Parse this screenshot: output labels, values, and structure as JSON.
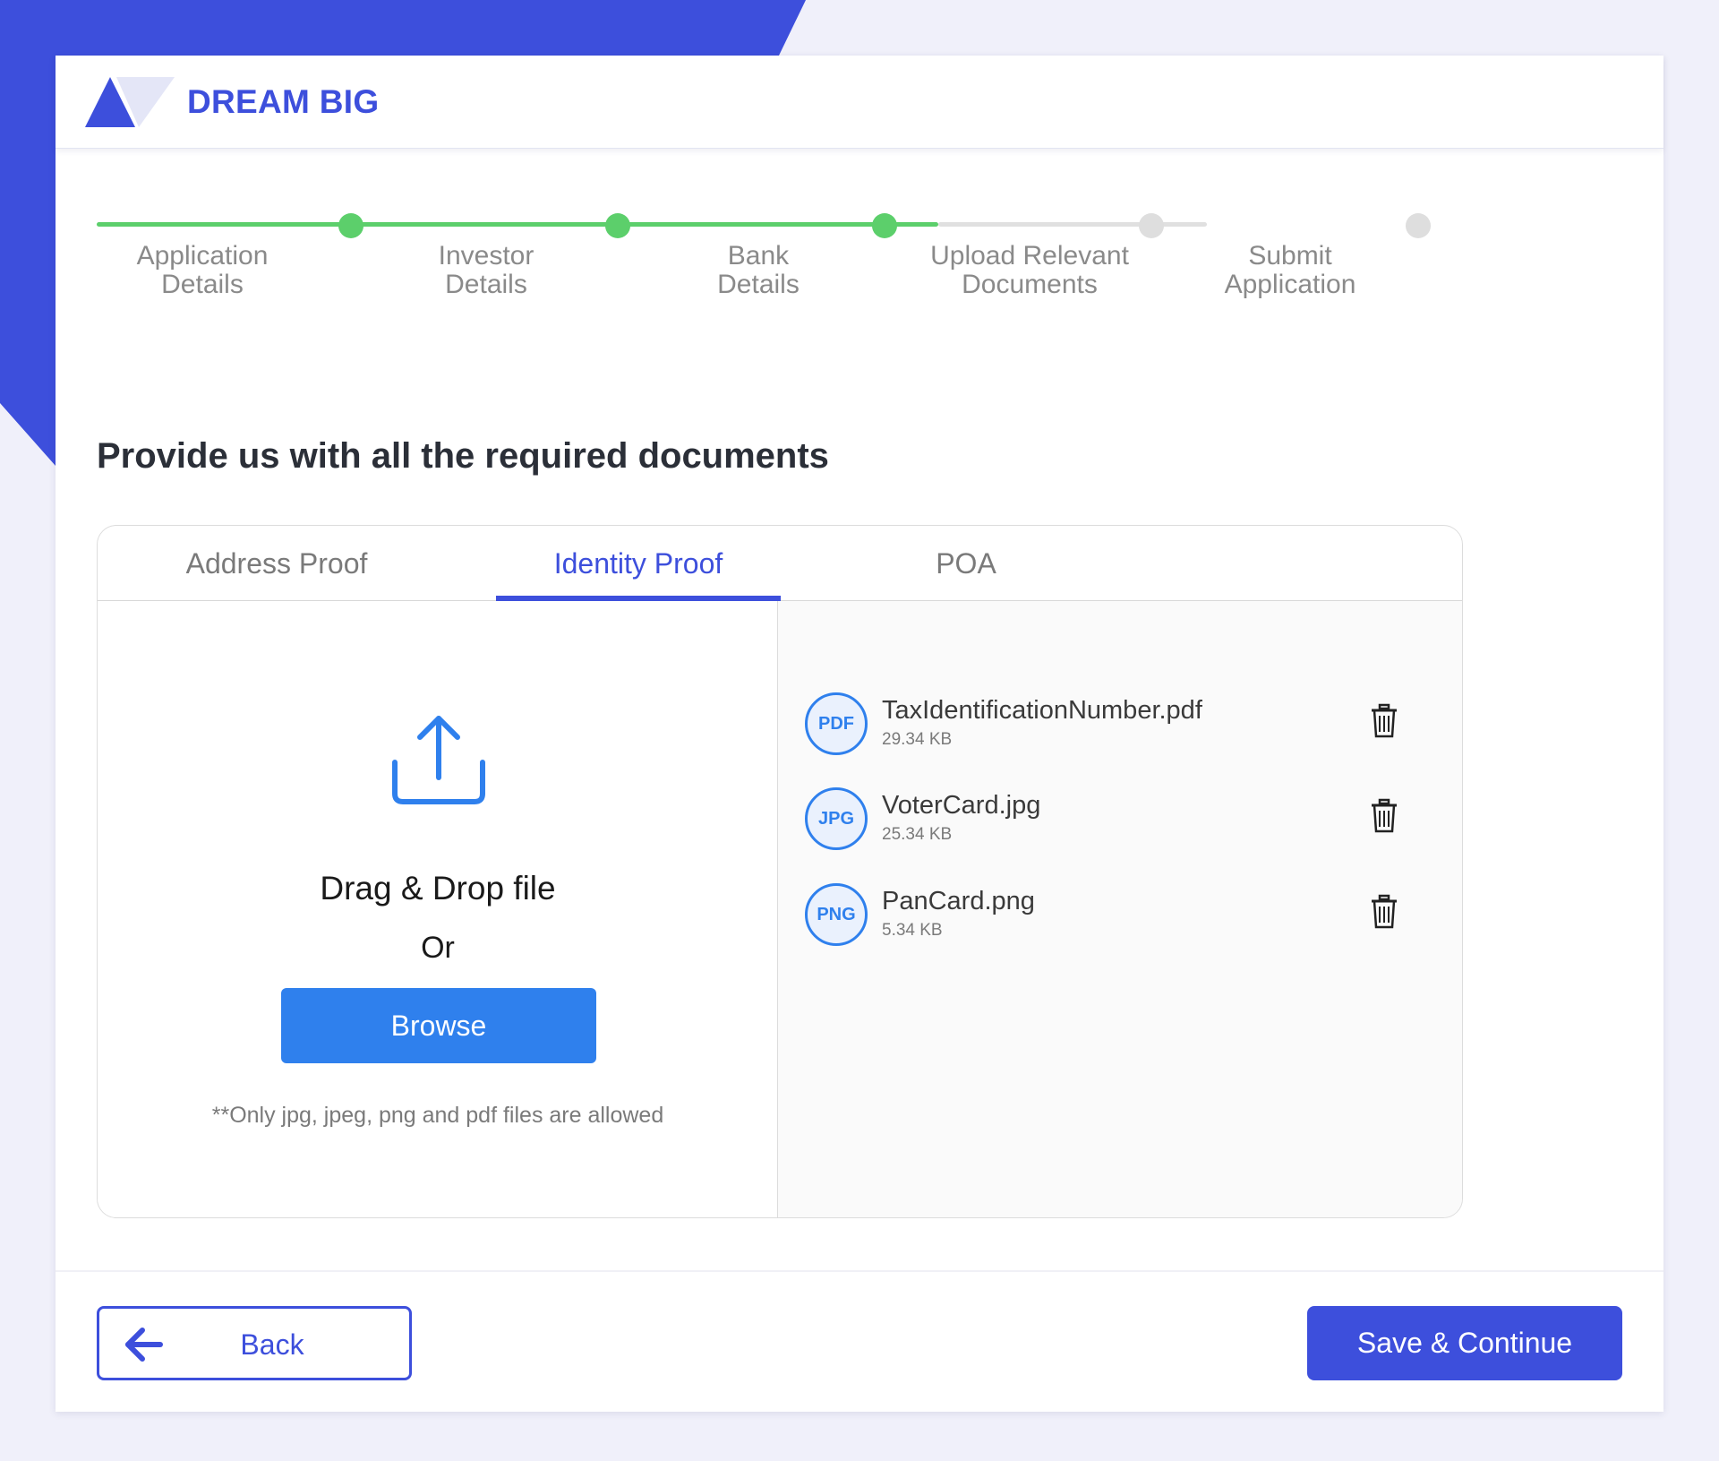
{
  "brand": {
    "name": "DREAM BIG",
    "logo_icon": "triangle-logo-icon"
  },
  "stepper": {
    "steps": [
      {
        "line1": "Application",
        "line2": "Details",
        "status": "complete"
      },
      {
        "line1": "Investor",
        "line2": "Details",
        "status": "complete"
      },
      {
        "line1": "Bank",
        "line2": "Details",
        "status": "complete"
      },
      {
        "line1": "Upload Relevant",
        "line2": "Documents",
        "status": "current"
      },
      {
        "line1": "Submit",
        "line2": "Application",
        "status": "pending"
      }
    ]
  },
  "page_title": "Provide us with all the required documents",
  "tabs": [
    {
      "label": "Address Proof",
      "active": false
    },
    {
      "label": "Identity Proof",
      "active": true
    },
    {
      "label": "POA",
      "active": false
    }
  ],
  "upload": {
    "drag_text": "Drag & Drop file",
    "or_text": "Or",
    "browse_label": "Browse",
    "note": "**Only jpg, jpeg, png and pdf files are allowed"
  },
  "files": [
    {
      "type": "PDF",
      "name": "TaxIdentificationNumber.pdf",
      "size": "29.34 KB"
    },
    {
      "type": "JPG",
      "name": "VoterCard.jpg",
      "size": "25.34 KB"
    },
    {
      "type": "PNG",
      "name": "PanCard.png",
      "size": "5.34 KB"
    }
  ],
  "footer": {
    "back_label": "Back",
    "save_label": "Save & Continue"
  },
  "colors": {
    "primary": "#3d4fdc",
    "accent_blue": "#2f80ed",
    "step_done": "#5ccf6b",
    "step_todo": "#dedede"
  }
}
